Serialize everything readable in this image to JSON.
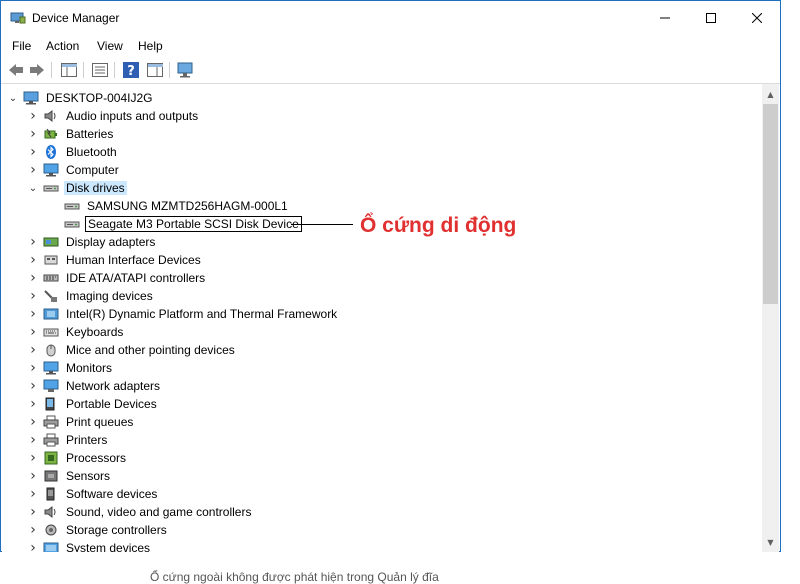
{
  "window": {
    "title": "Device Manager"
  },
  "menu": [
    "File",
    "Action",
    "View",
    "Help"
  ],
  "tree": {
    "root": "DESKTOP-004IJ2G",
    "items": [
      {
        "label": "Audio inputs and outputs",
        "icon": "speaker-icon"
      },
      {
        "label": "Batteries",
        "icon": "battery-icon"
      },
      {
        "label": "Bluetooth",
        "icon": "bluetooth-icon"
      },
      {
        "label": "Computer",
        "icon": "monitor-icon"
      },
      {
        "label": "Disk drives",
        "icon": "disk-drive-icon",
        "expanded": true,
        "children": [
          "SAMSUNG MZMTD256HAGM-000L1",
          "Seagate M3 Portable SCSI Disk Device"
        ]
      },
      {
        "label": "Display adapters",
        "icon": "display-adapter-icon"
      },
      {
        "label": "Human Interface Devices",
        "icon": "hid-icon"
      },
      {
        "label": "IDE ATA/ATAPI controllers",
        "icon": "ide-controller-icon"
      },
      {
        "label": "Imaging devices",
        "icon": "camera-icon"
      },
      {
        "label": "Intel(R) Dynamic Platform and Thermal Framework",
        "icon": "chip-icon"
      },
      {
        "label": "Keyboards",
        "icon": "keyboard-icon"
      },
      {
        "label": "Mice and other pointing devices",
        "icon": "mouse-icon"
      },
      {
        "label": "Monitors",
        "icon": "monitor-icon"
      },
      {
        "label": "Network adapters",
        "icon": "network-icon"
      },
      {
        "label": "Portable Devices",
        "icon": "portable-device-icon"
      },
      {
        "label": "Print queues",
        "icon": "printer-icon"
      },
      {
        "label": "Printers",
        "icon": "printer-icon"
      },
      {
        "label": "Processors",
        "icon": "processor-icon"
      },
      {
        "label": "Sensors",
        "icon": "sensor-icon"
      },
      {
        "label": "Software devices",
        "icon": "software-device-icon"
      },
      {
        "label": "Sound, video and game controllers",
        "icon": "speaker-icon"
      },
      {
        "label": "Storage controllers",
        "icon": "storage-controller-icon"
      },
      {
        "label": "System devices",
        "icon": "system-device-icon"
      }
    ]
  },
  "annotation": "Ổ cứng di động",
  "annotation_color": "#e03030",
  "bottom_caption": "Ổ cứng ngoài không được phát hiện trong Quản lý đĩa"
}
